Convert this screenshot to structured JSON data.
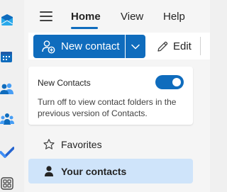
{
  "app_rail": {
    "items": [
      {
        "name": "outlook-mail-icon"
      },
      {
        "name": "calendar-icon"
      },
      {
        "name": "people-icon"
      },
      {
        "name": "groups-icon"
      },
      {
        "name": "todo-icon"
      },
      {
        "name": "more-apps-icon"
      }
    ]
  },
  "header": {
    "tabs": [
      {
        "label": "Home",
        "active": true
      },
      {
        "label": "View",
        "active": false
      },
      {
        "label": "Help",
        "active": false
      }
    ]
  },
  "ribbon": {
    "new_contact_label": "New contact",
    "edit_label": "Edit"
  },
  "new_contacts_card": {
    "title": "New Contacts",
    "description": "Turn off to view contact folders in the previous version of Contacts.",
    "toggle_on": true
  },
  "nav": {
    "favorites_label": "Favorites",
    "your_contacts_label": "Your contacts"
  },
  "colors": {
    "accent": "#0f6cbd",
    "selected_bg": "#cfe4fa"
  }
}
